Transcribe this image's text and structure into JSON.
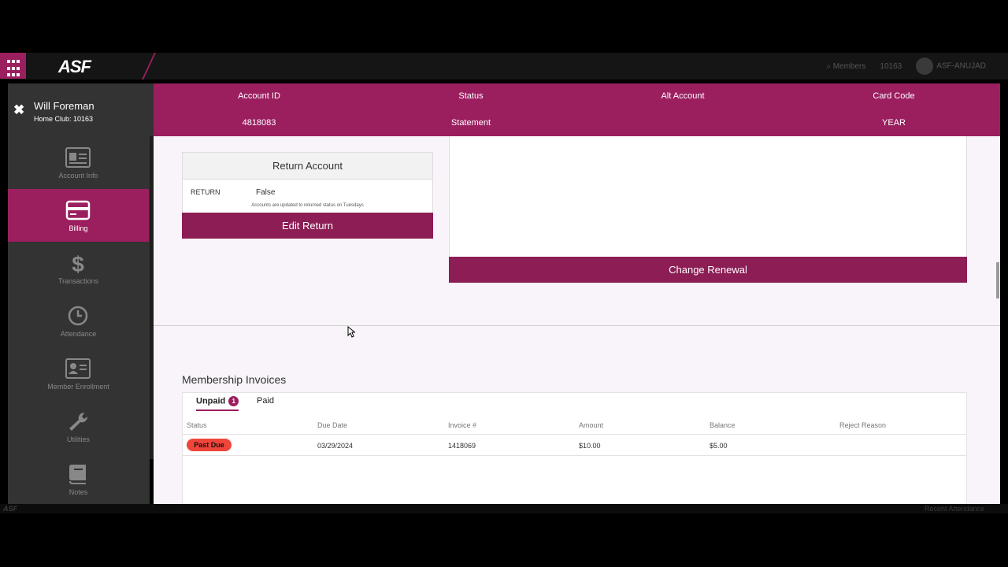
{
  "app": {
    "logo": "ASF"
  },
  "topbar": {
    "members": "Members",
    "club": "10163",
    "user": "ASF-ANUJAD"
  },
  "member": {
    "name": "Will Foreman",
    "home_club": "Home Club: 10163"
  },
  "account": [
    {
      "label": "Account ID",
      "value": "4818083"
    },
    {
      "label": "Status",
      "value": "Statement"
    },
    {
      "label": "Alt Account",
      "value": ""
    },
    {
      "label": "Card Code",
      "value": "YEAR"
    }
  ],
  "sidebar": {
    "items": [
      {
        "label": "Account Info",
        "icon": "id-card-icon",
        "active": false
      },
      {
        "label": "Billing",
        "icon": "credit-card-icon",
        "active": true
      },
      {
        "label": "Transactions",
        "icon": "dollar-icon",
        "active": false
      },
      {
        "label": "Attendance",
        "icon": "clock-icon",
        "active": false
      },
      {
        "label": "Member Enrollment",
        "icon": "member-card-icon",
        "active": false
      },
      {
        "label": "Utilities",
        "icon": "wrench-icon",
        "active": false
      },
      {
        "label": "Notes",
        "icon": "notebook-icon",
        "active": false
      }
    ]
  },
  "return_account": {
    "title": "Return Account",
    "label": "RETURN",
    "value": "False",
    "note": "Accounts are updated to returned status on Tuesdays",
    "button": "Edit Return"
  },
  "renewal": {
    "button": "Change Renewal"
  },
  "invoices": {
    "title": "Membership Invoices",
    "tabs": [
      {
        "label": "Unpaid",
        "badge": "1"
      },
      {
        "label": "Paid"
      }
    ],
    "columns": [
      "Status",
      "Due Date",
      "Invoice #",
      "Amount",
      "Balance",
      "Reject Reason"
    ],
    "rows": [
      {
        "status": "Past Due",
        "due_date": "03/29/2024",
        "invoice": "1418069",
        "amount": "$10.00",
        "balance": "$5.00",
        "reject_reason": ""
      }
    ]
  },
  "footer": {
    "right": "Recent Attendance"
  },
  "colors": {
    "brand": "#9b1f5f",
    "button": "#8c1d55",
    "past_due": "#f0453a"
  }
}
